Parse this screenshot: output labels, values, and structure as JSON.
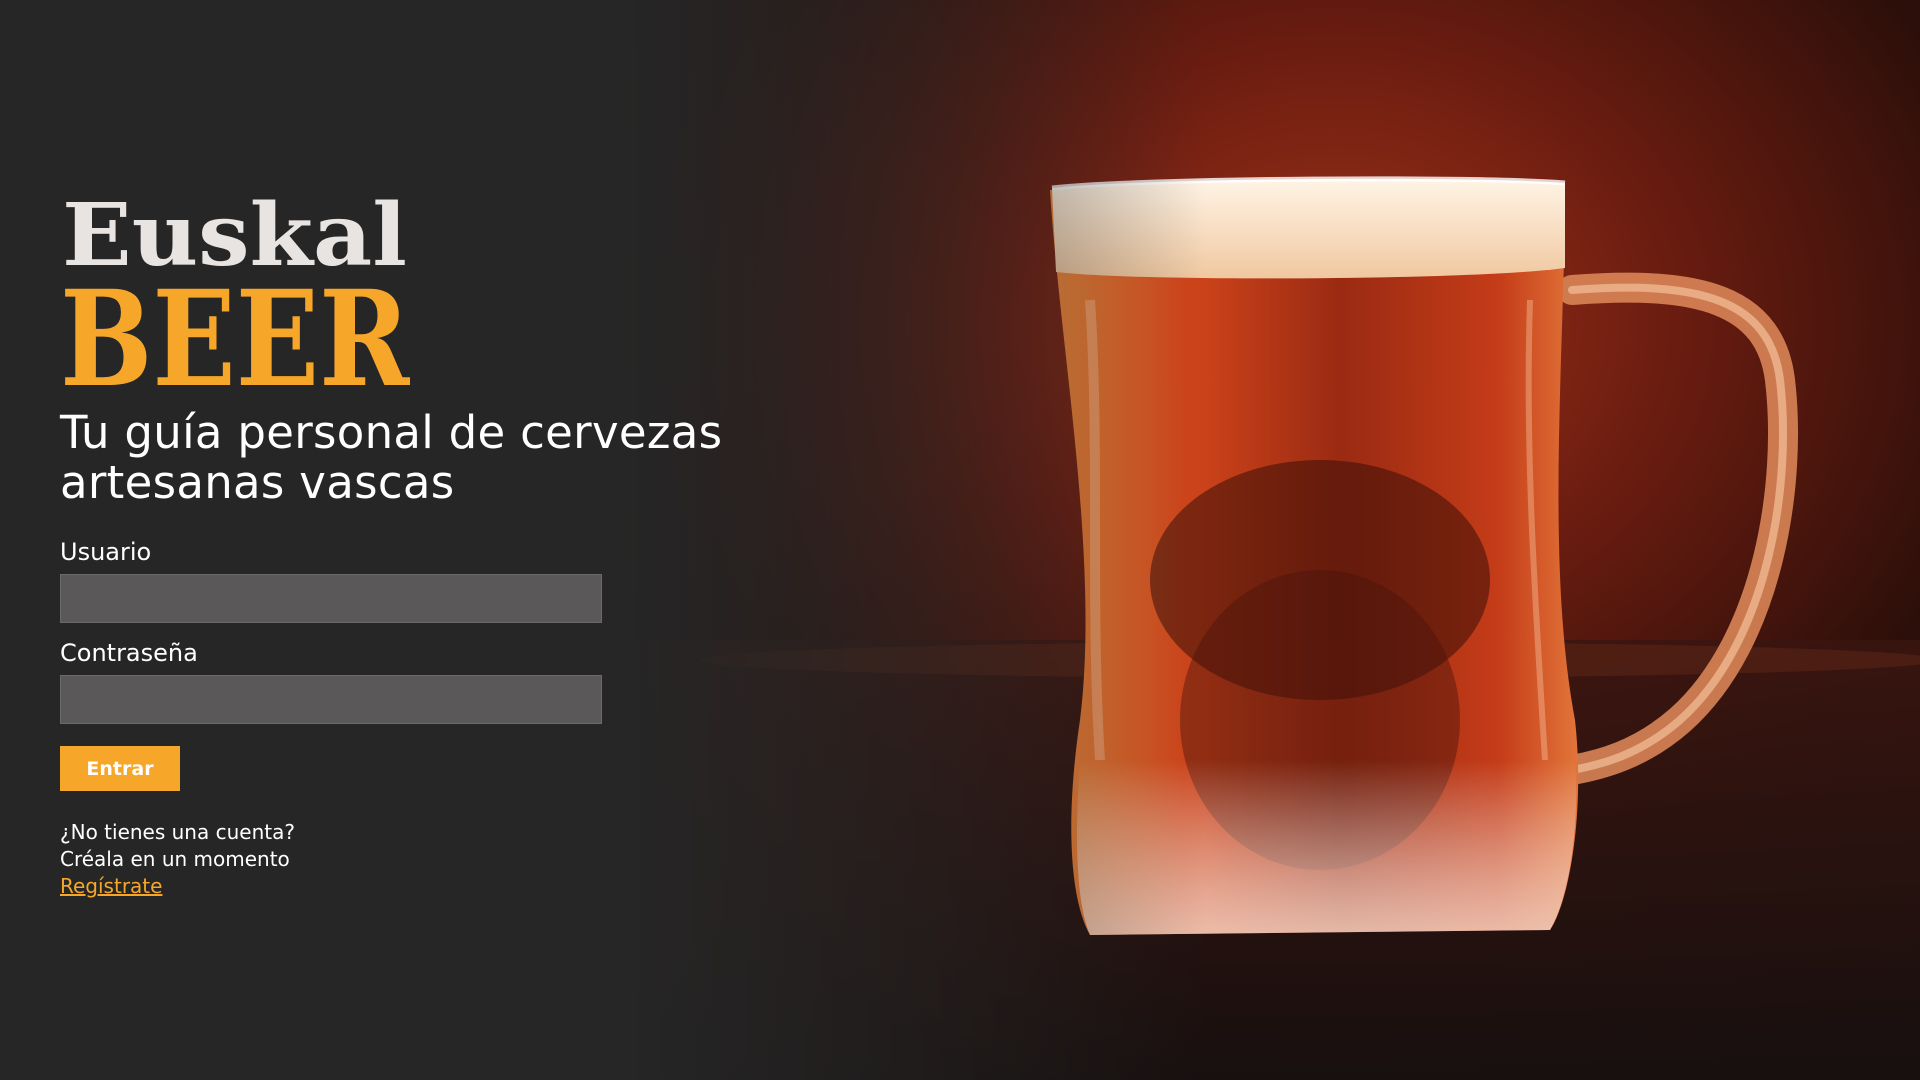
{
  "brand": {
    "logo_top": "Euskal",
    "logo_bottom": "BEER",
    "logo_top_color": "#e8e4e2",
    "logo_bottom_color": "#f6a72a"
  },
  "tagline": "Tu guía personal de cervezas artesanas vascas",
  "form": {
    "username_label": "Usuario",
    "username_value": "",
    "password_label": "Contraseña",
    "password_value": "",
    "submit_label": "Entrar"
  },
  "signup": {
    "question": "¿No tienes una cuenta?",
    "prompt": "Créala en un momento",
    "link_label": "Regístrate"
  },
  "colors": {
    "background": "#262626",
    "accent": "#f6a72a",
    "input_background": "#5a5859"
  },
  "hero_image": {
    "subject": "beer-mug"
  }
}
